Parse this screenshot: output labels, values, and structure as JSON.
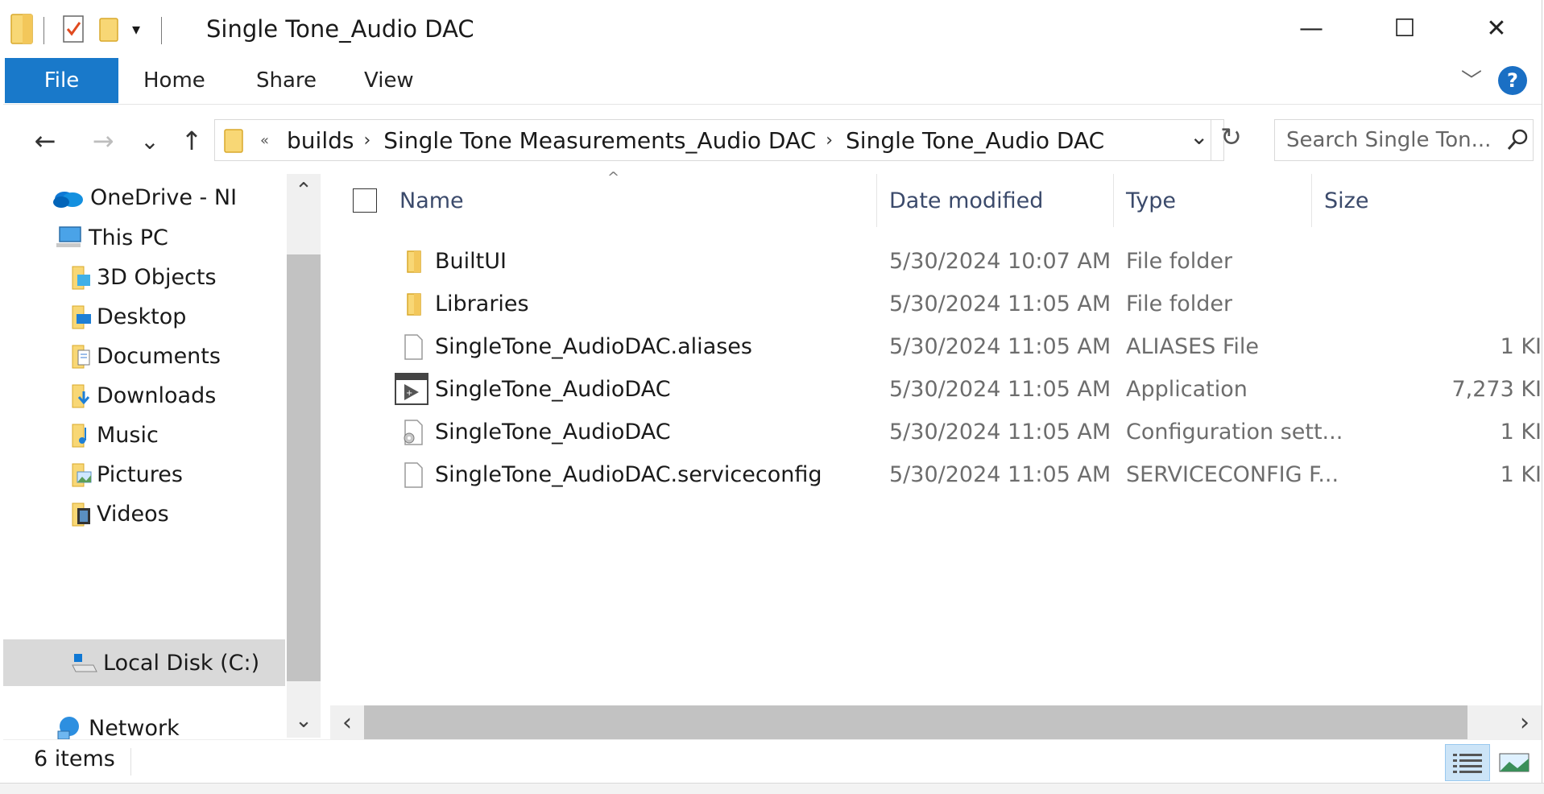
{
  "window": {
    "title": "Single Tone_Audio DAC",
    "minimize_glyph": "—",
    "maximize_glyph": "☐",
    "close_glyph": "✕"
  },
  "ribbon": {
    "tabs": [
      {
        "label": "File"
      },
      {
        "label": "Home"
      },
      {
        "label": "Share"
      },
      {
        "label": "View"
      }
    ],
    "help_glyph": "?",
    "expand_glyph": "﹀"
  },
  "nav": {
    "back_glyph": "←",
    "forward_glyph": "→",
    "recent_glyph": "⌄",
    "up_glyph": "↑",
    "overflow_glyph": "«",
    "breadcrumb": [
      "builds",
      "Single Tone Measurements_Audio DAC",
      "Single Tone_Audio DAC"
    ],
    "crumb_separator": "›",
    "dropdown_glyph": "⌄",
    "refresh_glyph": "↻",
    "search_placeholder": "Search Single Ton..."
  },
  "navpane": {
    "scroll_up_glyph": "⌃",
    "scroll_down_glyph": "⌄",
    "items": [
      {
        "label": "OneDrive - NI",
        "icon": "onedrive-icon"
      },
      {
        "label": "This PC",
        "icon": "computer-icon"
      },
      {
        "label": "3D Objects",
        "icon": "3d-objects-icon"
      },
      {
        "label": "Desktop",
        "icon": "desktop-folder-icon"
      },
      {
        "label": "Documents",
        "icon": "documents-folder-icon"
      },
      {
        "label": "Downloads",
        "icon": "downloads-folder-icon"
      },
      {
        "label": "Music",
        "icon": "music-folder-icon"
      },
      {
        "label": "Pictures",
        "icon": "pictures-folder-icon"
      },
      {
        "label": "Videos",
        "icon": "videos-folder-icon"
      },
      {
        "label": "Local Disk (C:)",
        "icon": "drive-icon",
        "selected": true
      },
      {
        "label": "Network",
        "icon": "network-icon"
      }
    ]
  },
  "filelist": {
    "sort_glyph": "^",
    "columns": {
      "name": "Name",
      "date": "Date modified",
      "type": "Type",
      "size": "Size"
    },
    "rows": [
      {
        "name": "BuiltUI",
        "date": "5/30/2024 10:07 AM",
        "type": "File folder",
        "size": "",
        "icon": "folder-icon"
      },
      {
        "name": "Libraries",
        "date": "5/30/2024 11:05 AM",
        "type": "File folder",
        "size": "",
        "icon": "folder-icon"
      },
      {
        "name": "SingleTone_AudioDAC.aliases",
        "date": "5/30/2024 11:05 AM",
        "type": "ALIASES File",
        "size": "1 KI",
        "icon": "file-icon"
      },
      {
        "name": "SingleTone_AudioDAC",
        "date": "5/30/2024 11:05 AM",
        "type": "Application",
        "size": "7,273 KI",
        "icon": "application-icon"
      },
      {
        "name": "SingleTone_AudioDAC",
        "date": "5/30/2024 11:05 AM",
        "type": "Configuration sett...",
        "size": "1 KI",
        "icon": "config-file-icon"
      },
      {
        "name": "SingleTone_AudioDAC.serviceconfig",
        "date": "5/30/2024 11:05 AM",
        "type": "SERVICECONFIG F...",
        "size": "1 KI",
        "icon": "file-icon"
      }
    ],
    "scroll_left_glyph": "‹",
    "scroll_right_glyph": "›"
  },
  "status": {
    "item_count": "6 items"
  },
  "colors": {
    "accent": "#1979ca",
    "folder": "#f8d775",
    "selected_bg": "#d9d9d9"
  }
}
